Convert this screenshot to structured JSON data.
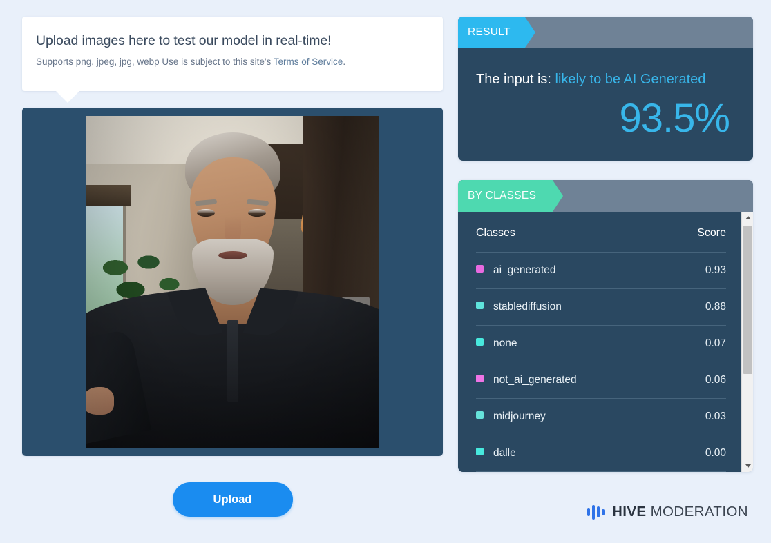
{
  "page": {
    "background_color": "#e9f0fa"
  },
  "upload_card": {
    "title": "Upload images here to test our model in real-time!",
    "subtitle_prefix": "Supports png, jpeg, jpg, webp Use is subject to this site's ",
    "tos_link": "Terms of Service",
    "subtitle_suffix": "."
  },
  "preview": {
    "frame_color": "#2b4f6d",
    "alt": "selfie photo of a gray-haired bearded man in a dark polo shirt standing in a home hallway with kitchen behind"
  },
  "upload_button": {
    "label": "Upload",
    "color": "#1a8cf0"
  },
  "result_panel": {
    "tab_label": "RESULT",
    "tab_color": "#2db9ef",
    "prefix": "The input is:",
    "verdict": "likely to be AI Generated",
    "percentage": "93.5%",
    "accent_color": "#38b6ea",
    "body_color": "#2a4861"
  },
  "classes_panel": {
    "tab_label": "BY CLASSES",
    "tab_color": "#4ed9b0",
    "columns": {
      "classes": "Classes",
      "score": "Score"
    },
    "rows": [
      {
        "name": "ai_generated",
        "score": "0.93",
        "color": "#e86ae0"
      },
      {
        "name": "stablediffusion",
        "score": "0.88",
        "color": "#5fe3dc"
      },
      {
        "name": "none",
        "score": "0.07",
        "color": "#48e8dd"
      },
      {
        "name": "not_ai_generated",
        "score": "0.06",
        "color": "#ef74e6"
      },
      {
        "name": "midjourney",
        "score": "0.03",
        "color": "#66e2da"
      },
      {
        "name": "dalle",
        "score": "0.00",
        "color": "#47e9de"
      }
    ],
    "scrollbar": {
      "up_arrow": "scroll-up",
      "down_arrow": "scroll-down"
    }
  },
  "footer": {
    "brand_bold": "HIVE",
    "brand_rest": "MODERATION",
    "logo_color": "#2f73e8"
  }
}
